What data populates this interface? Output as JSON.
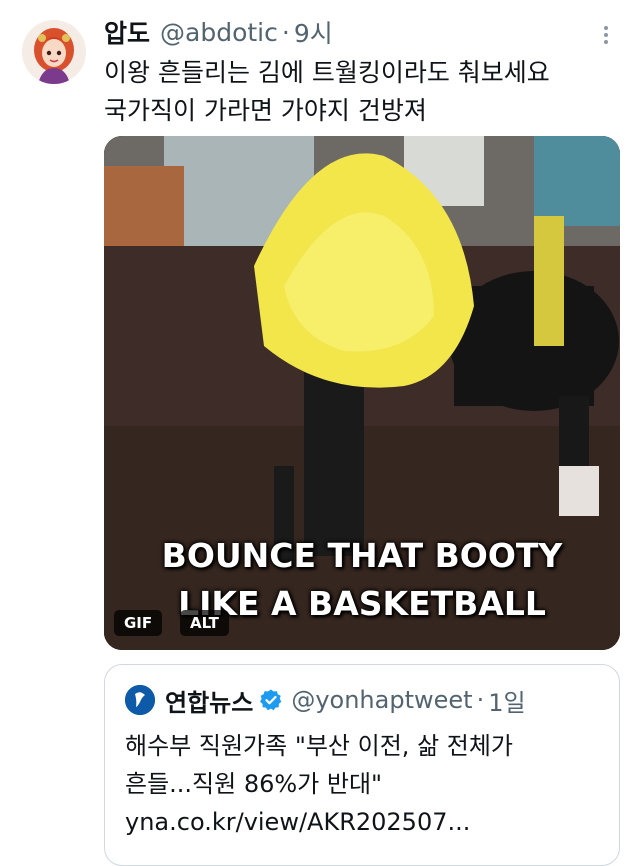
{
  "tweet": {
    "display_name": "압도",
    "handle": "@abdotic",
    "separator": "·",
    "time": "9시",
    "text_line1": "이왕 흔들리는 김에 트월킹이라도 춰보세요",
    "text_line2": "국가직이 가라면 가야지 건방져",
    "more_icon": "more-vertical-icon"
  },
  "media": {
    "caption_line1": "BOUNCE THAT BOOTY",
    "caption_line2": "LIKE A BASKETBALL",
    "gif_badge": "GIF",
    "alt_badge": "ALT"
  },
  "quote": {
    "display_name": "연합뉴스",
    "handle": "@yonhaptweet",
    "separator": "·",
    "time": "1일",
    "text_line1": "해수부 직원가족 \"부산 이전, 삶 전체가",
    "text_line2": "흔들...직원 86%가 반대\"",
    "link": "yna.co.kr/view/AKR202507...",
    "verified_icon": "verified-badge-icon"
  },
  "colors": {
    "text_primary": "#0f1419",
    "text_secondary": "#536471",
    "border": "#cfd9de",
    "verified_blue": "#1d9bf0",
    "caption": "#ffffff"
  }
}
